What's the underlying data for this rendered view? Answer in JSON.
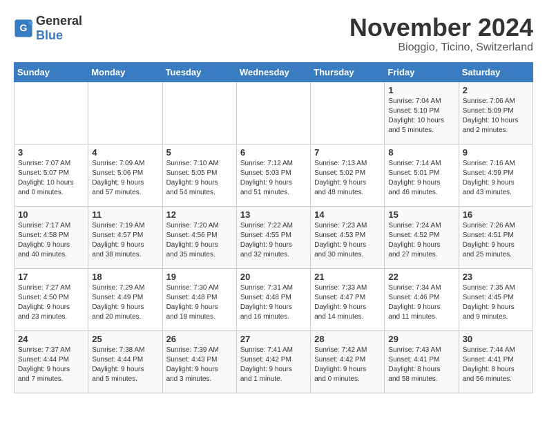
{
  "logo": {
    "text_general": "General",
    "text_blue": "Blue"
  },
  "title": {
    "month": "November 2024",
    "location": "Bioggio, Ticino, Switzerland"
  },
  "weekdays": [
    "Sunday",
    "Monday",
    "Tuesday",
    "Wednesday",
    "Thursday",
    "Friday",
    "Saturday"
  ],
  "weeks": [
    [
      {
        "day": "",
        "info": ""
      },
      {
        "day": "",
        "info": ""
      },
      {
        "day": "",
        "info": ""
      },
      {
        "day": "",
        "info": ""
      },
      {
        "day": "",
        "info": ""
      },
      {
        "day": "1",
        "info": "Sunrise: 7:04 AM\nSunset: 5:10 PM\nDaylight: 10 hours\nand 5 minutes."
      },
      {
        "day": "2",
        "info": "Sunrise: 7:06 AM\nSunset: 5:09 PM\nDaylight: 10 hours\nand 2 minutes."
      }
    ],
    [
      {
        "day": "3",
        "info": "Sunrise: 7:07 AM\nSunset: 5:07 PM\nDaylight: 10 hours\nand 0 minutes."
      },
      {
        "day": "4",
        "info": "Sunrise: 7:09 AM\nSunset: 5:06 PM\nDaylight: 9 hours\nand 57 minutes."
      },
      {
        "day": "5",
        "info": "Sunrise: 7:10 AM\nSunset: 5:05 PM\nDaylight: 9 hours\nand 54 minutes."
      },
      {
        "day": "6",
        "info": "Sunrise: 7:12 AM\nSunset: 5:03 PM\nDaylight: 9 hours\nand 51 minutes."
      },
      {
        "day": "7",
        "info": "Sunrise: 7:13 AM\nSunset: 5:02 PM\nDaylight: 9 hours\nand 48 minutes."
      },
      {
        "day": "8",
        "info": "Sunrise: 7:14 AM\nSunset: 5:01 PM\nDaylight: 9 hours\nand 46 minutes."
      },
      {
        "day": "9",
        "info": "Sunrise: 7:16 AM\nSunset: 4:59 PM\nDaylight: 9 hours\nand 43 minutes."
      }
    ],
    [
      {
        "day": "10",
        "info": "Sunrise: 7:17 AM\nSunset: 4:58 PM\nDaylight: 9 hours\nand 40 minutes."
      },
      {
        "day": "11",
        "info": "Sunrise: 7:19 AM\nSunset: 4:57 PM\nDaylight: 9 hours\nand 38 minutes."
      },
      {
        "day": "12",
        "info": "Sunrise: 7:20 AM\nSunset: 4:56 PM\nDaylight: 9 hours\nand 35 minutes."
      },
      {
        "day": "13",
        "info": "Sunrise: 7:22 AM\nSunset: 4:55 PM\nDaylight: 9 hours\nand 32 minutes."
      },
      {
        "day": "14",
        "info": "Sunrise: 7:23 AM\nSunset: 4:53 PM\nDaylight: 9 hours\nand 30 minutes."
      },
      {
        "day": "15",
        "info": "Sunrise: 7:24 AM\nSunset: 4:52 PM\nDaylight: 9 hours\nand 27 minutes."
      },
      {
        "day": "16",
        "info": "Sunrise: 7:26 AM\nSunset: 4:51 PM\nDaylight: 9 hours\nand 25 minutes."
      }
    ],
    [
      {
        "day": "17",
        "info": "Sunrise: 7:27 AM\nSunset: 4:50 PM\nDaylight: 9 hours\nand 23 minutes."
      },
      {
        "day": "18",
        "info": "Sunrise: 7:29 AM\nSunset: 4:49 PM\nDaylight: 9 hours\nand 20 minutes."
      },
      {
        "day": "19",
        "info": "Sunrise: 7:30 AM\nSunset: 4:48 PM\nDaylight: 9 hours\nand 18 minutes."
      },
      {
        "day": "20",
        "info": "Sunrise: 7:31 AM\nSunset: 4:48 PM\nDaylight: 9 hours\nand 16 minutes."
      },
      {
        "day": "21",
        "info": "Sunrise: 7:33 AM\nSunset: 4:47 PM\nDaylight: 9 hours\nand 14 minutes."
      },
      {
        "day": "22",
        "info": "Sunrise: 7:34 AM\nSunset: 4:46 PM\nDaylight: 9 hours\nand 11 minutes."
      },
      {
        "day": "23",
        "info": "Sunrise: 7:35 AM\nSunset: 4:45 PM\nDaylight: 9 hours\nand 9 minutes."
      }
    ],
    [
      {
        "day": "24",
        "info": "Sunrise: 7:37 AM\nSunset: 4:44 PM\nDaylight: 9 hours\nand 7 minutes."
      },
      {
        "day": "25",
        "info": "Sunrise: 7:38 AM\nSunset: 4:44 PM\nDaylight: 9 hours\nand 5 minutes."
      },
      {
        "day": "26",
        "info": "Sunrise: 7:39 AM\nSunset: 4:43 PM\nDaylight: 9 hours\nand 3 minutes."
      },
      {
        "day": "27",
        "info": "Sunrise: 7:41 AM\nSunset: 4:42 PM\nDaylight: 9 hours\nand 1 minute."
      },
      {
        "day": "28",
        "info": "Sunrise: 7:42 AM\nSunset: 4:42 PM\nDaylight: 9 hours\nand 0 minutes."
      },
      {
        "day": "29",
        "info": "Sunrise: 7:43 AM\nSunset: 4:41 PM\nDaylight: 8 hours\nand 58 minutes."
      },
      {
        "day": "30",
        "info": "Sunrise: 7:44 AM\nSunset: 4:41 PM\nDaylight: 8 hours\nand 56 minutes."
      }
    ]
  ]
}
